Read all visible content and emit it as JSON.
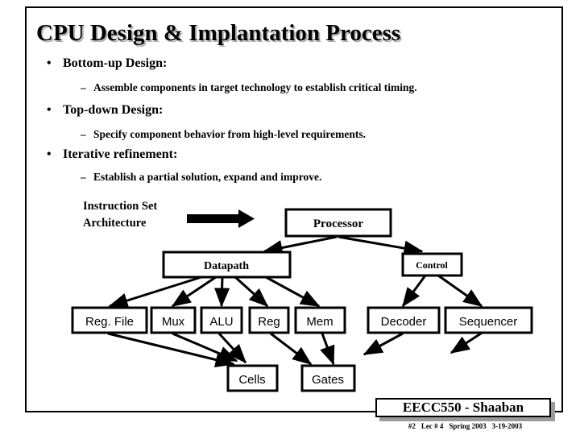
{
  "slide": {
    "title": "CPU Design & Implantation Process",
    "background_color": "#ffffff",
    "text_color": "#000000",
    "shadow_color": "#b0b0b0"
  },
  "bullets": [
    {
      "marker": "•",
      "text": "Bottom-up Design:",
      "sub": [
        {
          "marker": "–",
          "text": "Assemble components in target technology to establish critical timing."
        }
      ]
    },
    {
      "marker": "•",
      "text": "Top-down Design:",
      "sub": [
        {
          "marker": "–",
          "text": "Specify component behavior from high-level requirements."
        }
      ]
    },
    {
      "marker": "•",
      "text": "Iterative refinement:",
      "sub": [
        {
          "marker": "–",
          "text": "Establish a partial solution, expand and improve."
        }
      ]
    }
  ],
  "diagram": {
    "isa_label_line1": "Instruction Set",
    "isa_label_line2": "Architecture",
    "arrow_name": "block-arrow-isa-to-processor",
    "nodes": {
      "processor": "Processor",
      "datapath": "Datapath",
      "control": "Control",
      "reg_file": "Reg. File",
      "mux": "Mux",
      "alu": "ALU",
      "reg": "Reg",
      "mem": "Mem",
      "decoder": "Decoder",
      "sequencer": "Sequencer",
      "cells": "Cells",
      "gates": "Gates"
    }
  },
  "footer": {
    "title": "EECC550 - Shaaban",
    "slide_number": "#2",
    "lecture": "Lec # 4",
    "term": "Spring 2003",
    "date": "3-19-2003"
  }
}
